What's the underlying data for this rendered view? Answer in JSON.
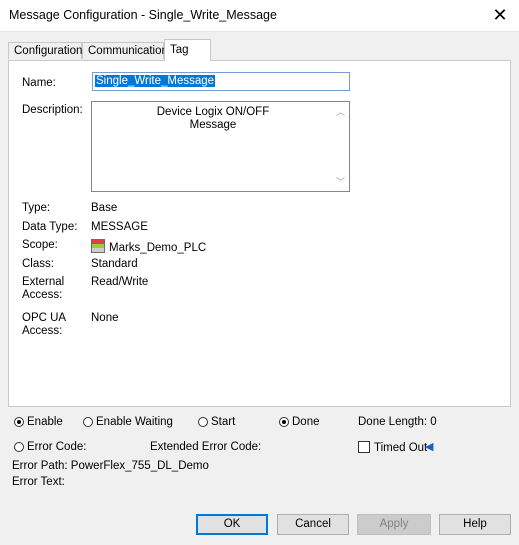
{
  "window": {
    "title": "Message Configuration - Single_Write_Message",
    "close_glyph": "✕"
  },
  "tabs": [
    {
      "label": "Configuration",
      "active": false
    },
    {
      "label": "Communication",
      "active": false
    },
    {
      "label": "Tag",
      "active": true
    }
  ],
  "tag": {
    "name_label": "Name:",
    "name_value": "Single_Write_Message",
    "description_label": "Description:",
    "description_lines": [
      "Device Logix ON/OFF",
      "Message"
    ],
    "type_label": "Type:",
    "type_value": "Base",
    "data_type_label": "Data Type:",
    "data_type_value": "MESSAGE",
    "scope_label": "Scope:",
    "scope_value": "Marks_Demo_PLC",
    "class_label": "Class:",
    "class_value": "Standard",
    "external_access_label_1": "External",
    "external_access_label_2": "Access:",
    "external_access_value": "Read/Write",
    "opc_ua_label_1": "OPC UA",
    "opc_ua_label_2": "Access:",
    "opc_ua_value": "None"
  },
  "status": {
    "enable": "Enable",
    "enable_waiting": "Enable Waiting",
    "start": "Start",
    "done": "Done",
    "done_length": "Done Length: 0",
    "error_code": "Error Code:",
    "extended_error_code": "Extended Error Code:",
    "timed_out": "Timed Out",
    "error_path": "Error Path: PowerFlex_755_DL_Demo",
    "error_text": "Error Text:"
  },
  "buttons": {
    "ok": "OK",
    "cancel": "Cancel",
    "apply": "Apply",
    "help": "Help"
  },
  "colors": {
    "selection": "#0078d7",
    "arrow": "#1f5fc4"
  }
}
